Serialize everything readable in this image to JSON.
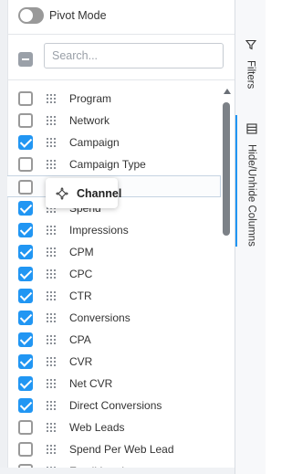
{
  "pivot": {
    "label": "Pivot Mode",
    "enabled": false
  },
  "search": {
    "placeholder": "Search..."
  },
  "columns": [
    {
      "label": "Program",
      "checked": false
    },
    {
      "label": "Network",
      "checked": false
    },
    {
      "label": "Campaign",
      "checked": true
    },
    {
      "label": "Campaign Type",
      "checked": false
    },
    {
      "label": "",
      "checked": false
    },
    {
      "label": "Spend",
      "checked": true
    },
    {
      "label": "Impressions",
      "checked": true
    },
    {
      "label": "CPM",
      "checked": true
    },
    {
      "label": "CPC",
      "checked": true
    },
    {
      "label": "CTR",
      "checked": true
    },
    {
      "label": "Conversions",
      "checked": true
    },
    {
      "label": "CPA",
      "checked": true
    },
    {
      "label": "CVR",
      "checked": true
    },
    {
      "label": "Net CVR",
      "checked": true
    },
    {
      "label": "Direct Conversions",
      "checked": true
    },
    {
      "label": "Web Leads",
      "checked": false
    },
    {
      "label": "Spend Per Web Lead",
      "checked": false
    },
    {
      "label": "Email Leads",
      "checked": false
    }
  ],
  "drag": {
    "label": "Channel",
    "icon": "move-icon"
  },
  "side_tabs": [
    {
      "label": "Filters",
      "icon": "filter-icon",
      "active": false
    },
    {
      "label": "Hide/Unhide Columns",
      "icon": "columns-icon",
      "active": true
    }
  ],
  "colors": {
    "accent": "#2196f3",
    "checkbox_border": "#999999"
  }
}
